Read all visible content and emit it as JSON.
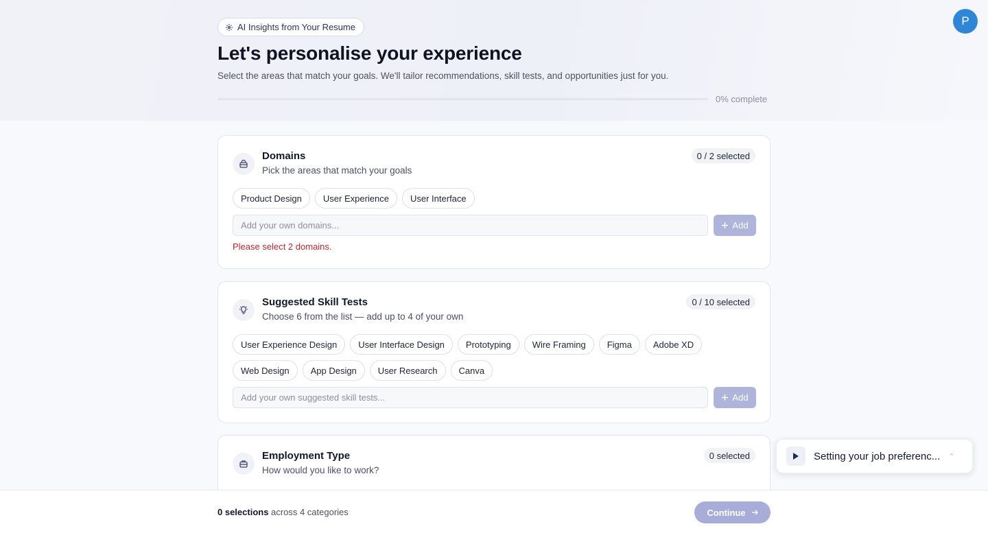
{
  "header": {
    "badge": "AI Insights from Your Resume",
    "title": "Let's personalise your experience",
    "subtitle": "Select the areas that match your goals. We'll tailor recommendations, skill tests, and opportunities just for you.",
    "progress_percent": 0,
    "progress_text": "0% complete",
    "avatar_initial": "P"
  },
  "domains": {
    "title": "Domains",
    "subtitle": "Pick the areas that match your goals",
    "count": "0 / 2 selected",
    "chips": [
      "Product Design",
      "User Experience",
      "User Interface"
    ],
    "placeholder": "Add your own domains...",
    "add_label": "Add",
    "error": "Please select 2 domains."
  },
  "skills": {
    "title": "Suggested Skill Tests",
    "subtitle": "Choose 6 from the list — add up to 4 of your own",
    "count": "0 / 10 selected",
    "chips": [
      "User Experience Design",
      "User Interface Design",
      "Prototyping",
      "Wire Framing",
      "Figma",
      "Adobe XD",
      "Web Design",
      "App Design",
      "User Research",
      "Canva"
    ],
    "placeholder": "Add your own suggested skill tests...",
    "add_label": "Add"
  },
  "employment": {
    "title": "Employment Type",
    "subtitle": "How would you like to work?",
    "count": "0 selected"
  },
  "footer": {
    "selections_bold": "0 selections",
    "selections_rest": " across 4 categories",
    "continue_label": "Continue"
  },
  "toast": {
    "text": "Setting your job preferenc..."
  },
  "colors": {
    "accent": "#6b72c4",
    "button_disabled": "#aeb4da",
    "avatar": "#2f86d6",
    "error": "#c0262d"
  }
}
